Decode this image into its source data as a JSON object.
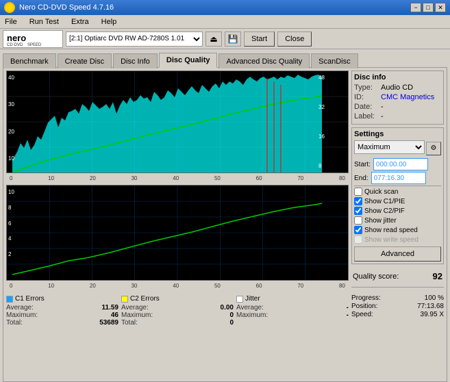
{
  "titleBar": {
    "title": "Nero CD-DVD Speed 4.7.16",
    "minimize": "−",
    "maximize": "□",
    "close": "✕"
  },
  "menu": {
    "items": [
      "File",
      "Run Test",
      "Extra",
      "Help"
    ]
  },
  "toolbar": {
    "driveLabel": "[2:1]  Optiarc DVD RW AD-7280S 1.01",
    "startLabel": "Start",
    "closeLabel": "Close"
  },
  "tabs": [
    {
      "label": "Benchmark",
      "active": false
    },
    {
      "label": "Create Disc",
      "active": false
    },
    {
      "label": "Disc Info",
      "active": false
    },
    {
      "label": "Disc Quality",
      "active": true
    },
    {
      "label": "Advanced Disc Quality",
      "active": false
    },
    {
      "label": "ScanDisc",
      "active": false
    }
  ],
  "discInfo": {
    "title": "Disc info",
    "type": {
      "label": "Type:",
      "value": "Audio CD"
    },
    "id": {
      "label": "ID:",
      "value": "CMC Magnetics"
    },
    "date": {
      "label": "Date:",
      "value": "-"
    },
    "label": {
      "label": "Label:",
      "value": "-"
    }
  },
  "settings": {
    "title": "Settings",
    "mode": "Maximum",
    "startLabel": "Start:",
    "startValue": "000:00.00",
    "endLabel": "End:",
    "endValue": "077:16.30",
    "quickScan": {
      "label": "Quick scan",
      "checked": false
    },
    "showC1PIE": {
      "label": "Show C1/PIE",
      "checked": true
    },
    "showC2PIF": {
      "label": "Show C2/PIF",
      "checked": true
    },
    "showJitter": {
      "label": "Show jitter",
      "checked": false
    },
    "showReadSpeed": {
      "label": "Show read speed",
      "checked": true
    },
    "showWriteSpeed": {
      "label": "Show write speed",
      "checked": false
    },
    "advancedLabel": "Advanced"
  },
  "quality": {
    "label": "Quality score:",
    "value": "92"
  },
  "progress": {
    "progressLabel": "Progress:",
    "progressValue": "100 %",
    "positionLabel": "Position:",
    "positionValue": "77:13.68",
    "speedLabel": "Speed:",
    "speedValue": "39.95 X"
  },
  "c1errors": {
    "title": "C1 Errors",
    "avgLabel": "Average:",
    "avgValue": "11.59",
    "maxLabel": "Maximum:",
    "maxValue": "46",
    "totalLabel": "Total:",
    "totalValue": "53689",
    "color": "#00aaff"
  },
  "c2errors": {
    "title": "C2 Errors",
    "avgLabel": "Average:",
    "avgValue": "0.00",
    "maxLabel": "Maximum:",
    "maxValue": "0",
    "totalLabel": "Total:",
    "totalValue": "0",
    "color": "#ffff00"
  },
  "jitter": {
    "title": "Jitter",
    "avgLabel": "Average:",
    "avgValue": "-",
    "maxLabel": "Maximum:",
    "maxValue": "-",
    "color": "#ffffff"
  },
  "upperChart": {
    "yLabels": [
      "40",
      "30",
      "20",
      "10"
    ],
    "yLabelsRight": [
      "48",
      "32",
      "16",
      "8"
    ],
    "xLabels": [
      "0",
      "10",
      "20",
      "30",
      "40",
      "50",
      "60",
      "70",
      "80"
    ]
  },
  "lowerChart": {
    "yLabels": [
      "10",
      "8",
      "6",
      "4",
      "2"
    ],
    "xLabels": [
      "0",
      "10",
      "20",
      "30",
      "40",
      "50",
      "60",
      "70",
      "80"
    ]
  }
}
